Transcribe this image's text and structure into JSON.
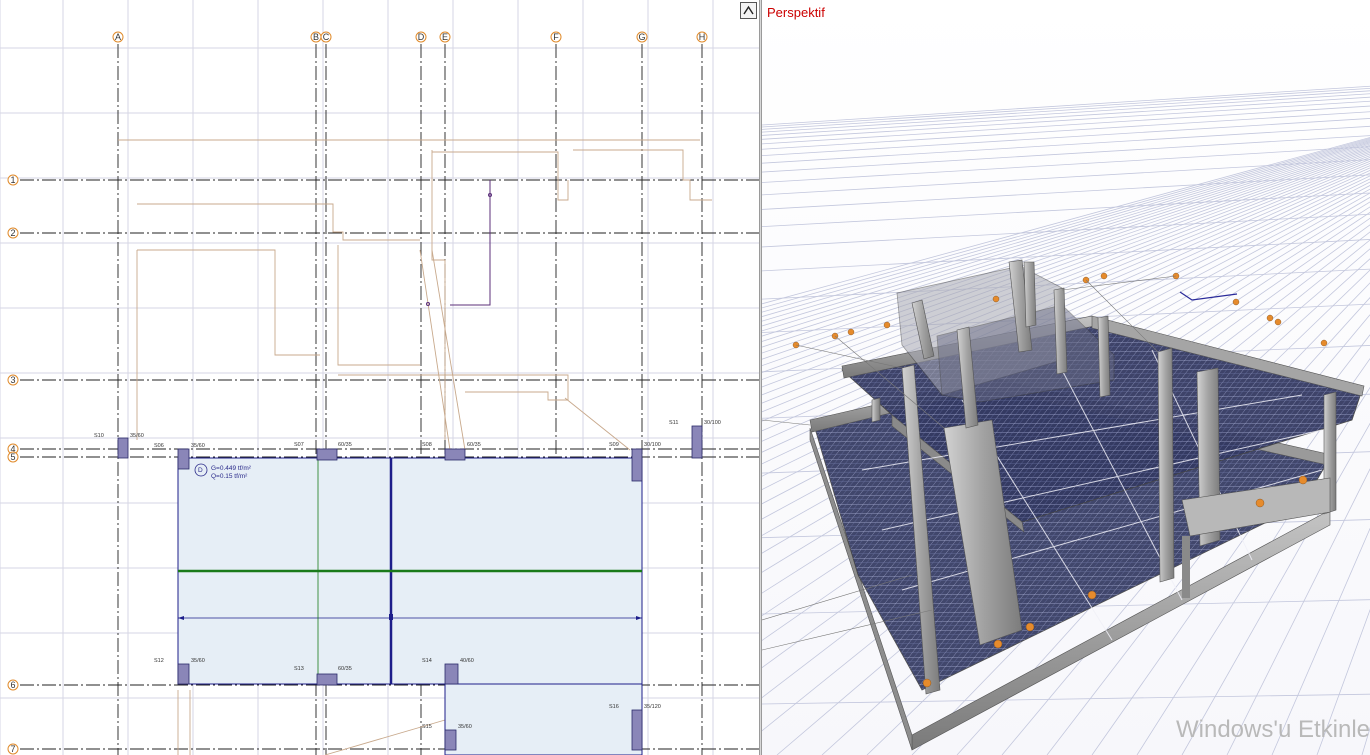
{
  "plan": {
    "axes_x": [
      "A",
      "B",
      "C",
      "D",
      "E",
      "F",
      "G",
      "H"
    ],
    "axes_y": [
      "1",
      "2",
      "3",
      "4",
      "5",
      "6",
      "7"
    ],
    "columns": [
      {
        "name": "S10",
        "size": "35/60"
      },
      {
        "name": "S06",
        "size": "35/60"
      },
      {
        "name": "S07",
        "size": "60/35"
      },
      {
        "name": "S08",
        "size": "60/35"
      },
      {
        "name": "S09",
        "size": "30/100"
      },
      {
        "name": "S11",
        "size": "30/100"
      },
      {
        "name": "S12",
        "size": "35/60"
      },
      {
        "name": "S13",
        "size": "60/35"
      },
      {
        "name": "S14",
        "size": "40/60"
      },
      {
        "name": "S15",
        "size": "35/60"
      },
      {
        "name": "S16",
        "size": "35/120"
      }
    ],
    "slab_load": {
      "dead": "G=0.449 tf/m²",
      "live": "Q=0.15 tf/m²"
    }
  },
  "perspective": {
    "title": "Perspektif"
  },
  "watermark": "Windows'u Etkinle",
  "colors": {
    "slab_fill": "#e6eef6",
    "beam_green": "#1a7a1a",
    "beam_blue": "#1d1d8a",
    "perspective_title": "#cc0000"
  }
}
